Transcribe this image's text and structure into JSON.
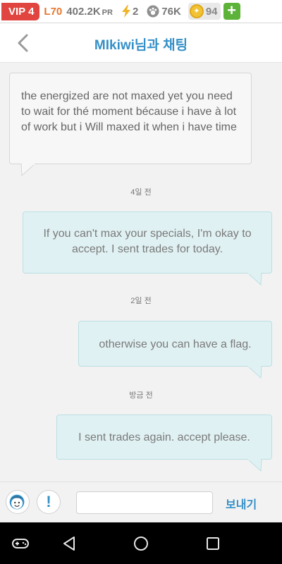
{
  "status_bar": {
    "vip": "VIP 4",
    "level": "L70",
    "power": "402.2K",
    "power_unit": "PR",
    "energy": "2",
    "food": "76K",
    "coins": "94",
    "add_label": "+"
  },
  "header": {
    "title": "MIkiwi님과 채팅"
  },
  "messages": [
    {
      "direction": "incoming",
      "text": "the energized are not maxed yet you need to wait for thé moment bécause i have à lot of work but i Will maxed it when i have time"
    },
    {
      "direction": "timestamp",
      "text": "4일 전"
    },
    {
      "direction": "outgoing",
      "text": "If you can't max your specials, I'm okay to accept. I sent trades for today."
    },
    {
      "direction": "timestamp",
      "text": "2일 전"
    },
    {
      "direction": "outgoing",
      "text": "otherwise you can have a flag."
    },
    {
      "direction": "timestamp",
      "text": "방금 전"
    },
    {
      "direction": "outgoing",
      "text": "I sent trades again. accept please."
    }
  ],
  "input_bar": {
    "alert_label": "!",
    "input_value": "",
    "input_placeholder": "",
    "send_label": "보내기"
  },
  "colors": {
    "accent": "#3590c7",
    "vip_red": "#e0463f",
    "level_orange": "#e8772e",
    "add_green": "#5db33a",
    "outgoing_bubble": "#e0f1f3"
  },
  "icons": [
    "bolt-icon",
    "paw-icon",
    "coin-icon",
    "back-arrow-icon",
    "emoji-face-icon",
    "gamepad-icon",
    "back-triangle-icon",
    "home-circle-icon",
    "recents-square-icon"
  ]
}
